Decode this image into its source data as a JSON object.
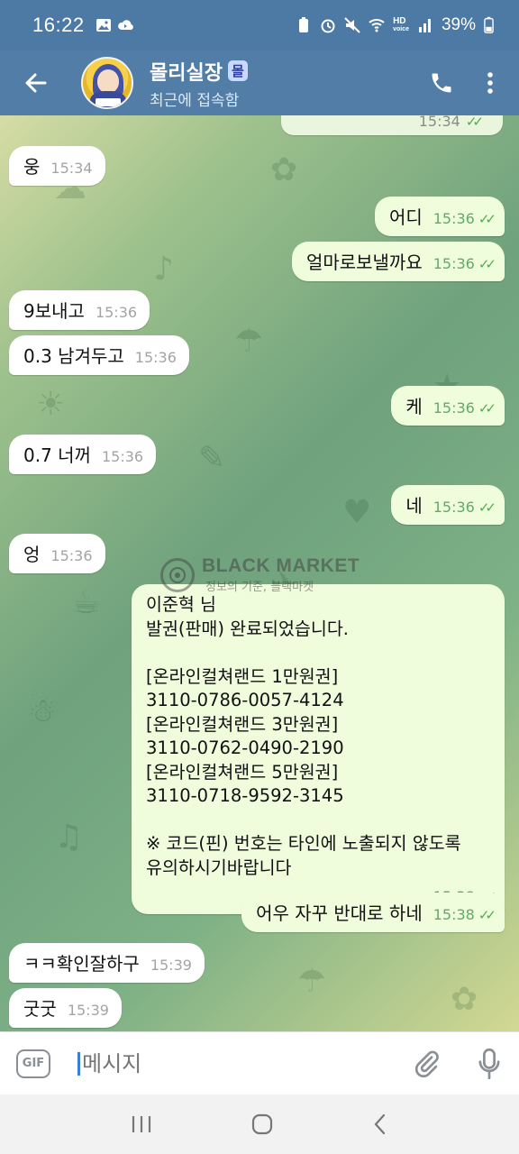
{
  "status_bar": {
    "time": "16:22",
    "hd_label": "HD",
    "hd_sub": "voice",
    "battery": "39%"
  },
  "header": {
    "title": "몰리실장",
    "badge": "몰",
    "subtitle": "최근에 접속함"
  },
  "partial_message": {
    "time": "15:34"
  },
  "messages": [
    {
      "dir": "in",
      "text": "웅",
      "time": "15:34"
    },
    {
      "dir": "out",
      "text": "어디",
      "time": "15:36"
    },
    {
      "dir": "out",
      "text": "얼마로보낼까요",
      "time": "15:36"
    },
    {
      "dir": "in",
      "text": "9보내고",
      "time": "15:36"
    },
    {
      "dir": "in",
      "text": "0.3 남겨두고",
      "time": "15:36"
    },
    {
      "dir": "out",
      "text": "케",
      "time": "15:36"
    },
    {
      "dir": "in",
      "text": "0.7 너꺼",
      "time": "15:36"
    },
    {
      "dir": "out",
      "text": "네",
      "time": "15:36"
    },
    {
      "dir": "in",
      "text": "엉",
      "time": "15:36"
    },
    {
      "dir": "out",
      "text": "이준혁 님\n발권(판매) 완료되었습니다.\n\n[온라인컬쳐랜드 1만원권]\n3110-0786-0057-4124\n[온라인컬쳐랜드 3만원권]\n3110-0762-0490-2190\n[온라인컬쳐랜드 5만원권]\n3110-0718-9592-3145\n\n※ 코드(핀) 번호는 타인에 노출되지 않도록\n유의하시기바랍니다",
      "time": "15:38"
    },
    {
      "dir": "out",
      "text": "어우 자꾸 반대로 하네",
      "time": "15:38"
    },
    {
      "dir": "in",
      "text": "ㅋㅋ확인잘하구",
      "time": "15:39"
    },
    {
      "dir": "in",
      "text": "굿굿",
      "time": "15:39"
    }
  ],
  "watermark": {
    "logo": "BLACK MARKET",
    "title": "BLACK MARKET",
    "subtitle": "정보의 기준, 블랙마켓"
  },
  "input": {
    "gif_label": "GIF",
    "placeholder": "메시지"
  },
  "icons": {
    "back": "arrow-left-icon",
    "call": "phone-icon",
    "menu": "more-vertical-icon",
    "attach": "paperclip-icon",
    "mic": "microphone-icon"
  }
}
